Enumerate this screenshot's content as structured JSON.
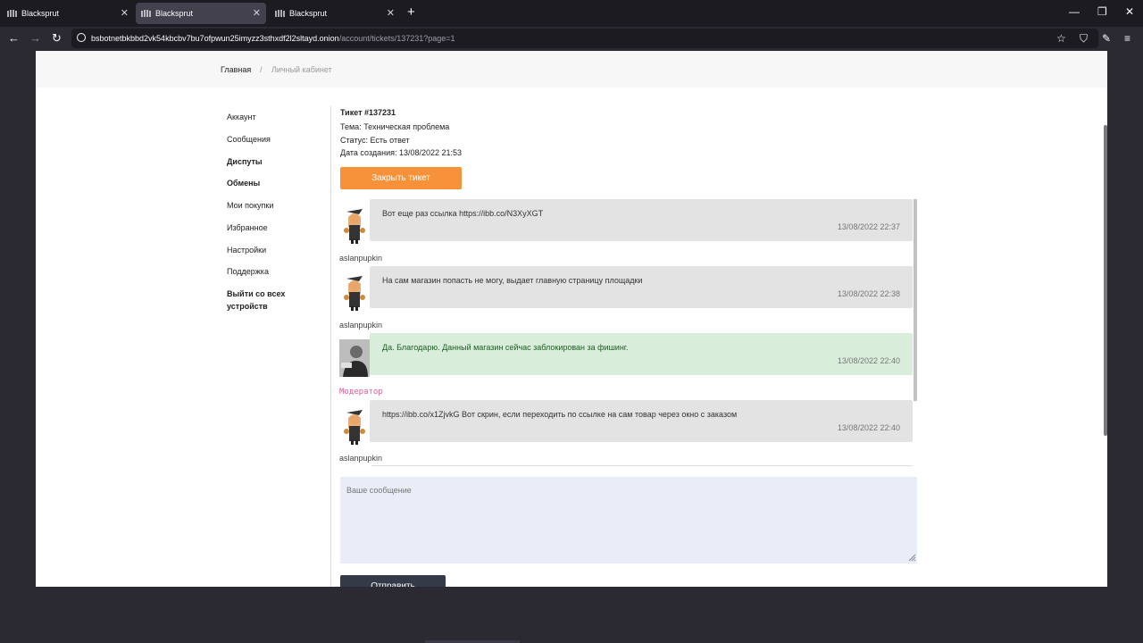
{
  "browser": {
    "tabs": [
      {
        "title": "Blacksprut",
        "active": false
      },
      {
        "title": "Blacksprut",
        "active": true
      },
      {
        "title": "Blacksprut",
        "active": false
      }
    ],
    "new_tab": "+",
    "url_main": "bsbotnetbkbbd2vk54kbcbv7bu7ofpwun25imyzz3sthxdf2l2sltayd.onion",
    "url_path": "/account/tickets/137231?page=1"
  },
  "breadcrumb": {
    "home": "Главная",
    "separator": "/",
    "current": "Личный кабинет"
  },
  "sidebar": {
    "items": [
      {
        "label": "Аккаунт",
        "bold": false
      },
      {
        "label": "Сообщения",
        "bold": false
      },
      {
        "label": "Диспуты",
        "bold": true
      },
      {
        "label": "Обмены",
        "bold": true
      },
      {
        "label": "Мои покупки",
        "bold": false
      },
      {
        "label": "Избранное",
        "bold": false
      },
      {
        "label": "Настройки",
        "bold": false
      },
      {
        "label": "Поддержка",
        "bold": false
      },
      {
        "label": "Выйти со всех",
        "bold": true
      },
      {
        "label": "устройств",
        "bold": true
      }
    ]
  },
  "ticket": {
    "title": "Тикет #137231",
    "subject": "Тема: Техническая проблема",
    "status": "Статус: Есть ответ",
    "created": "Дата создания: 13/08/2022 21:53",
    "close_button": "Закрыть тикет"
  },
  "messages": [
    {
      "text": "Вот еще раз ссылка https://ibb.co/N3XyXGT",
      "time": "13/08/2022 22:37",
      "author": "aslanpupkin",
      "role": "user"
    },
    {
      "text": "На сам магазин попасть не могу, выдает главную страницу площадки",
      "time": "13/08/2022 22:38",
      "author": "aslanpupkin",
      "role": "user"
    },
    {
      "text": "Да. Благодарю. Данный магазин сейчас заблокирован за фишинг.",
      "time": "13/08/2022 22:40",
      "author": "Модератор",
      "role": "moderator"
    },
    {
      "text": "https://ibb.co/x1ZjvkG Вот скрин, если переходить по ссылке на сам товар через окно с заказом",
      "time": "13/08/2022 22:40",
      "author": "aslanpupkin",
      "role": "user"
    }
  ],
  "composer": {
    "placeholder": "Ваше сообщение",
    "send_button": "Отправить"
  },
  "colors": {
    "accent": "#f7923a",
    "moderator_bubble": "#d8eedb",
    "user_bubble": "#e3e3e3",
    "send_button": "#343a47"
  }
}
